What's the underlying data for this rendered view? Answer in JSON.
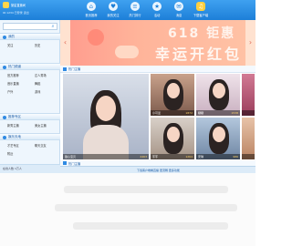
{
  "app": {
    "title": "繁星直播间",
    "user_info": "ID:1234  已登录 退出"
  },
  "nav": [
    {
      "label": "首页推荐",
      "icon": "home-icon",
      "glyph": "⌂"
    },
    {
      "label": "我的关注",
      "icon": "heart-icon",
      "glyph": "♥"
    },
    {
      "label": "热门排行",
      "icon": "rank-icon",
      "glyph": "≡"
    },
    {
      "label": "活动",
      "icon": "star-icon",
      "glyph": "★"
    },
    {
      "label": "消息",
      "icon": "bell-icon",
      "glyph": "✉"
    },
    {
      "label": "下载客户端",
      "icon": "download-icon",
      "glyph": "♫"
    }
  ],
  "sidebar": {
    "search_placeholder": "搜索",
    "sections": [
      {
        "title": "我的",
        "links": [
          "关注",
          "历史"
        ]
      },
      {
        "title": "热门频道",
        "links": [
          "官方推荐",
          "达人秀场",
          "音乐直播",
          "舞蹈",
          "户外",
          "游戏"
        ]
      },
      {
        "title": "推荐专区",
        "links": [
          "新秀主播",
          "美女主播"
        ]
      },
      {
        "title": "娱乐天地",
        "links": [
          "才艺专区",
          "聊天交友",
          "附近"
        ]
      }
    ],
    "footer": "在线人数 1万人"
  },
  "banner": {
    "line1": "618 钜惠",
    "line2": "幸运开红包",
    "left_arrow": "‹",
    "right_arrow": "›"
  },
  "sections": {
    "hot": "热门主播",
    "latest": "热门主播"
  },
  "tiles": [
    {
      "name": "甜心宝贝",
      "count": "2463"
    },
    {
      "name": "小可爱",
      "count": "1872"
    },
    {
      "name": "糖糖",
      "count": "1538"
    },
    {
      "name": "芊芊",
      "count": "1264"
    },
    {
      "name": "安琪",
      "count": "986"
    },
    {
      "name": "莉莉",
      "count": "845"
    },
    {
      "name": "贝儿",
      "count": "731"
    }
  ],
  "status": {
    "text": "下载客户端看直播 更流畅 更多功能"
  },
  "colors": {
    "primary": "#1d7fd8",
    "banner": "#ff9a8d",
    "sidebar": "#eef6fd"
  }
}
